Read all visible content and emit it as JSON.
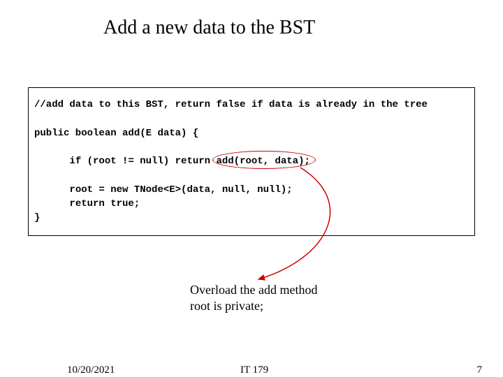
{
  "title": "Add a new data to the BST",
  "code": {
    "comment": "//add data to this BST, return false if data is already in the tree",
    "line2a": "public boolean ",
    "line2b": "add(E data) {",
    "line3a": "if (root != null) return ",
    "line3b": "add(root, data);",
    "line4": "root = new TNode<E>(data, null, null);",
    "line5": "return true;",
    "line6": "}"
  },
  "annotation": {
    "line1": "Overload the add method",
    "line2": "root is private;"
  },
  "footer": {
    "date": "10/20/2021",
    "course": "IT 179",
    "page": "7"
  }
}
